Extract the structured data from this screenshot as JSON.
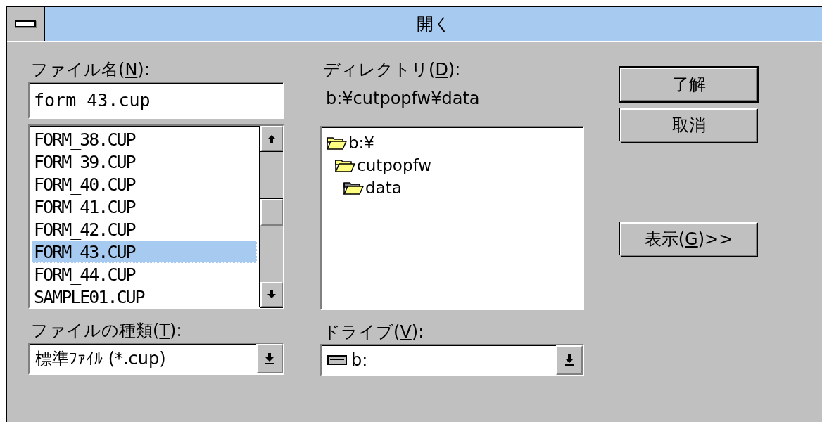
{
  "window": {
    "title": "開く"
  },
  "file_name": {
    "label": {
      "before": "ファイル名(",
      "key": "N",
      "after": "):"
    },
    "value": "form_43.cup"
  },
  "files": [
    {
      "name": "FORM_38.CUP",
      "selected": false
    },
    {
      "name": "FORM_39.CUP",
      "selected": false
    },
    {
      "name": "FORM_40.CUP",
      "selected": false
    },
    {
      "name": "FORM_41.CUP",
      "selected": false
    },
    {
      "name": "FORM_42.CUP",
      "selected": false
    },
    {
      "name": "FORM_43.CUP",
      "selected": true
    },
    {
      "name": "FORM_44.CUP",
      "selected": false
    },
    {
      "name": "SAMPLE01.CUP",
      "selected": false
    }
  ],
  "directory": {
    "label": {
      "before": "ディレクトリ(",
      "key": "D",
      "after": "):"
    },
    "path": "b:¥cutpopfw¥data",
    "tree": [
      {
        "name": "b:¥",
        "current": false,
        "children": [
          {
            "name": "cutpopfw",
            "current": false,
            "children": [
              {
                "name": "data",
                "current": true
              }
            ]
          }
        ]
      }
    ]
  },
  "file_type": {
    "label": {
      "before": "ファイルの種類(",
      "key": "T",
      "after": "):"
    },
    "value": "標準ﾌｧｲﾙ (*.cup)"
  },
  "drive": {
    "label": {
      "before": "ドライブ(",
      "key": "V",
      "after": "):"
    },
    "value": "b:"
  },
  "buttons": [
    {
      "label": {
        "before": "了解"
      },
      "default": true
    },
    {
      "label": {
        "before": "取消"
      },
      "default": false
    },
    {
      "label": {
        "before": "表示(",
        "key": "G",
        "after": ")>>"
      },
      "default": false
    }
  ]
}
